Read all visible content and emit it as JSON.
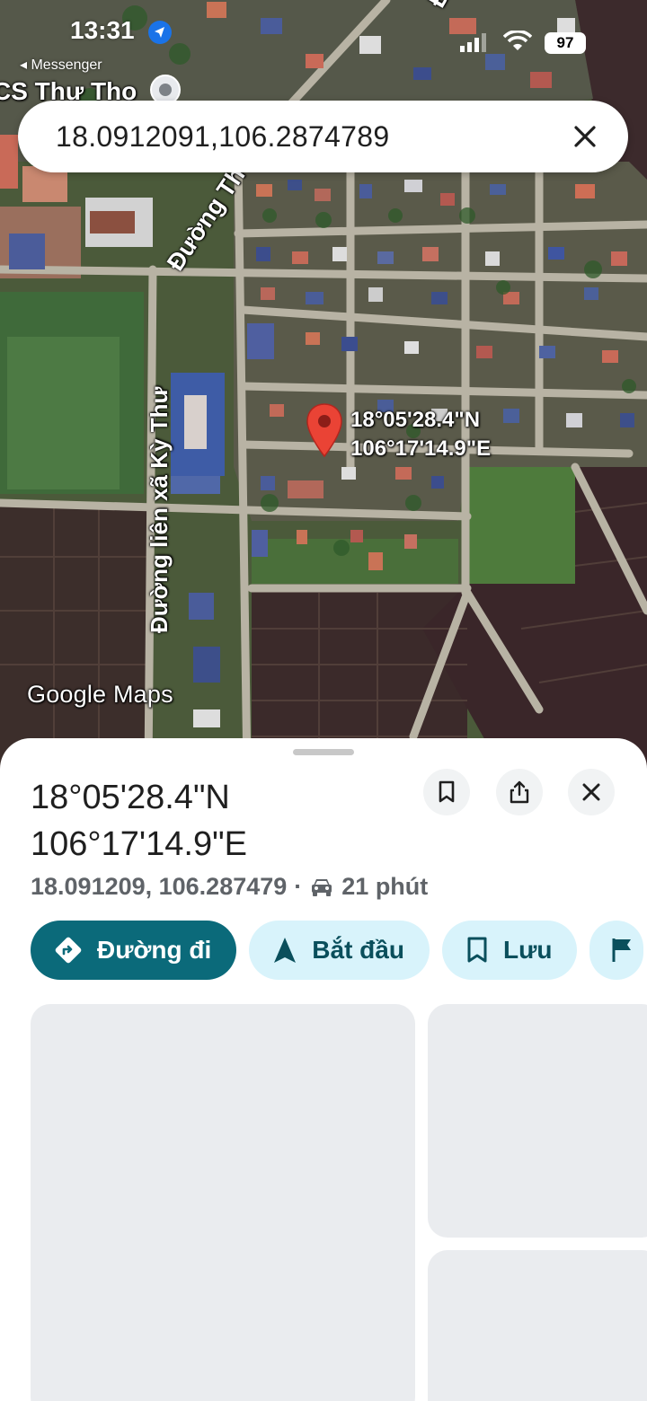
{
  "status_bar": {
    "time": "13:31",
    "back_app": "◂ Messenger",
    "battery": "97"
  },
  "search": {
    "query": "18.0912091,106.2874789"
  },
  "map": {
    "place_label": "CS Thư Tho",
    "road_label_1": "Đường Th",
    "road_label_2": "Đường liên xã Kỳ Thư",
    "road_label_top": "Đ",
    "pin_label_lat": "18°05'28.4\"N",
    "pin_label_lng": "106°17'14.9\"E",
    "watermark": "Google Maps",
    "pin_color": "#ea4335"
  },
  "sheet": {
    "title_lat": "18°05'28.4\"N",
    "title_lng": "106°17'14.9\"E",
    "decimal_coords": "18.091209, 106.287479",
    "separator": "·",
    "drive_time": "21 phút",
    "actions": {
      "directions": "Đường đi",
      "start": "Bắt đầu",
      "save": "Lưu"
    }
  },
  "colors": {
    "primary_chip": "#0b6a7a",
    "secondary_chip": "#d8f3fb",
    "placeholder": "#eaecef"
  }
}
